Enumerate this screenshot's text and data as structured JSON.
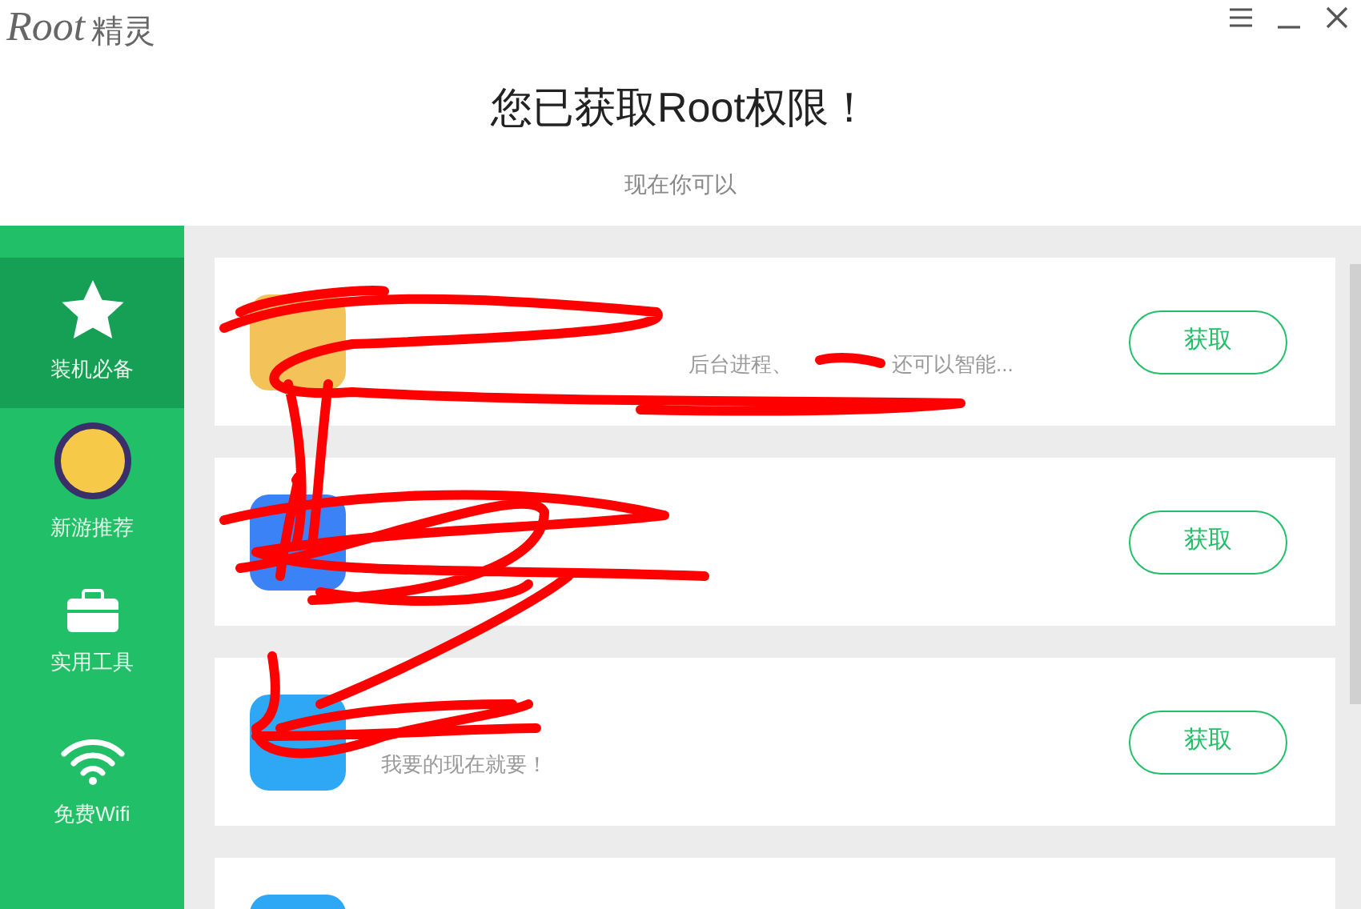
{
  "app": {
    "logo_latin": "Root",
    "logo_cn": "精灵"
  },
  "header": {
    "title": "您已获取Root权限！",
    "subtitle": "现在你可以"
  },
  "sidebar": {
    "items": [
      {
        "kind": "star",
        "label": "装机必备",
        "selected": true
      },
      {
        "kind": "game",
        "label": "新游推荐",
        "selected": false
      },
      {
        "kind": "toolbox",
        "label": "实用工具",
        "selected": false
      },
      {
        "kind": "wifi",
        "label": "免费Wifi",
        "selected": false
      }
    ]
  },
  "cards": [
    {
      "kind": "app",
      "description_parts": [
        "后台进程、",
        "还可以智能..."
      ],
      "button": "获取"
    },
    {
      "kind": "app",
      "button": "获取"
    },
    {
      "kind": "app",
      "description": "我要的现在就要！",
      "button": "获取"
    },
    {
      "kind": "app"
    }
  ]
}
